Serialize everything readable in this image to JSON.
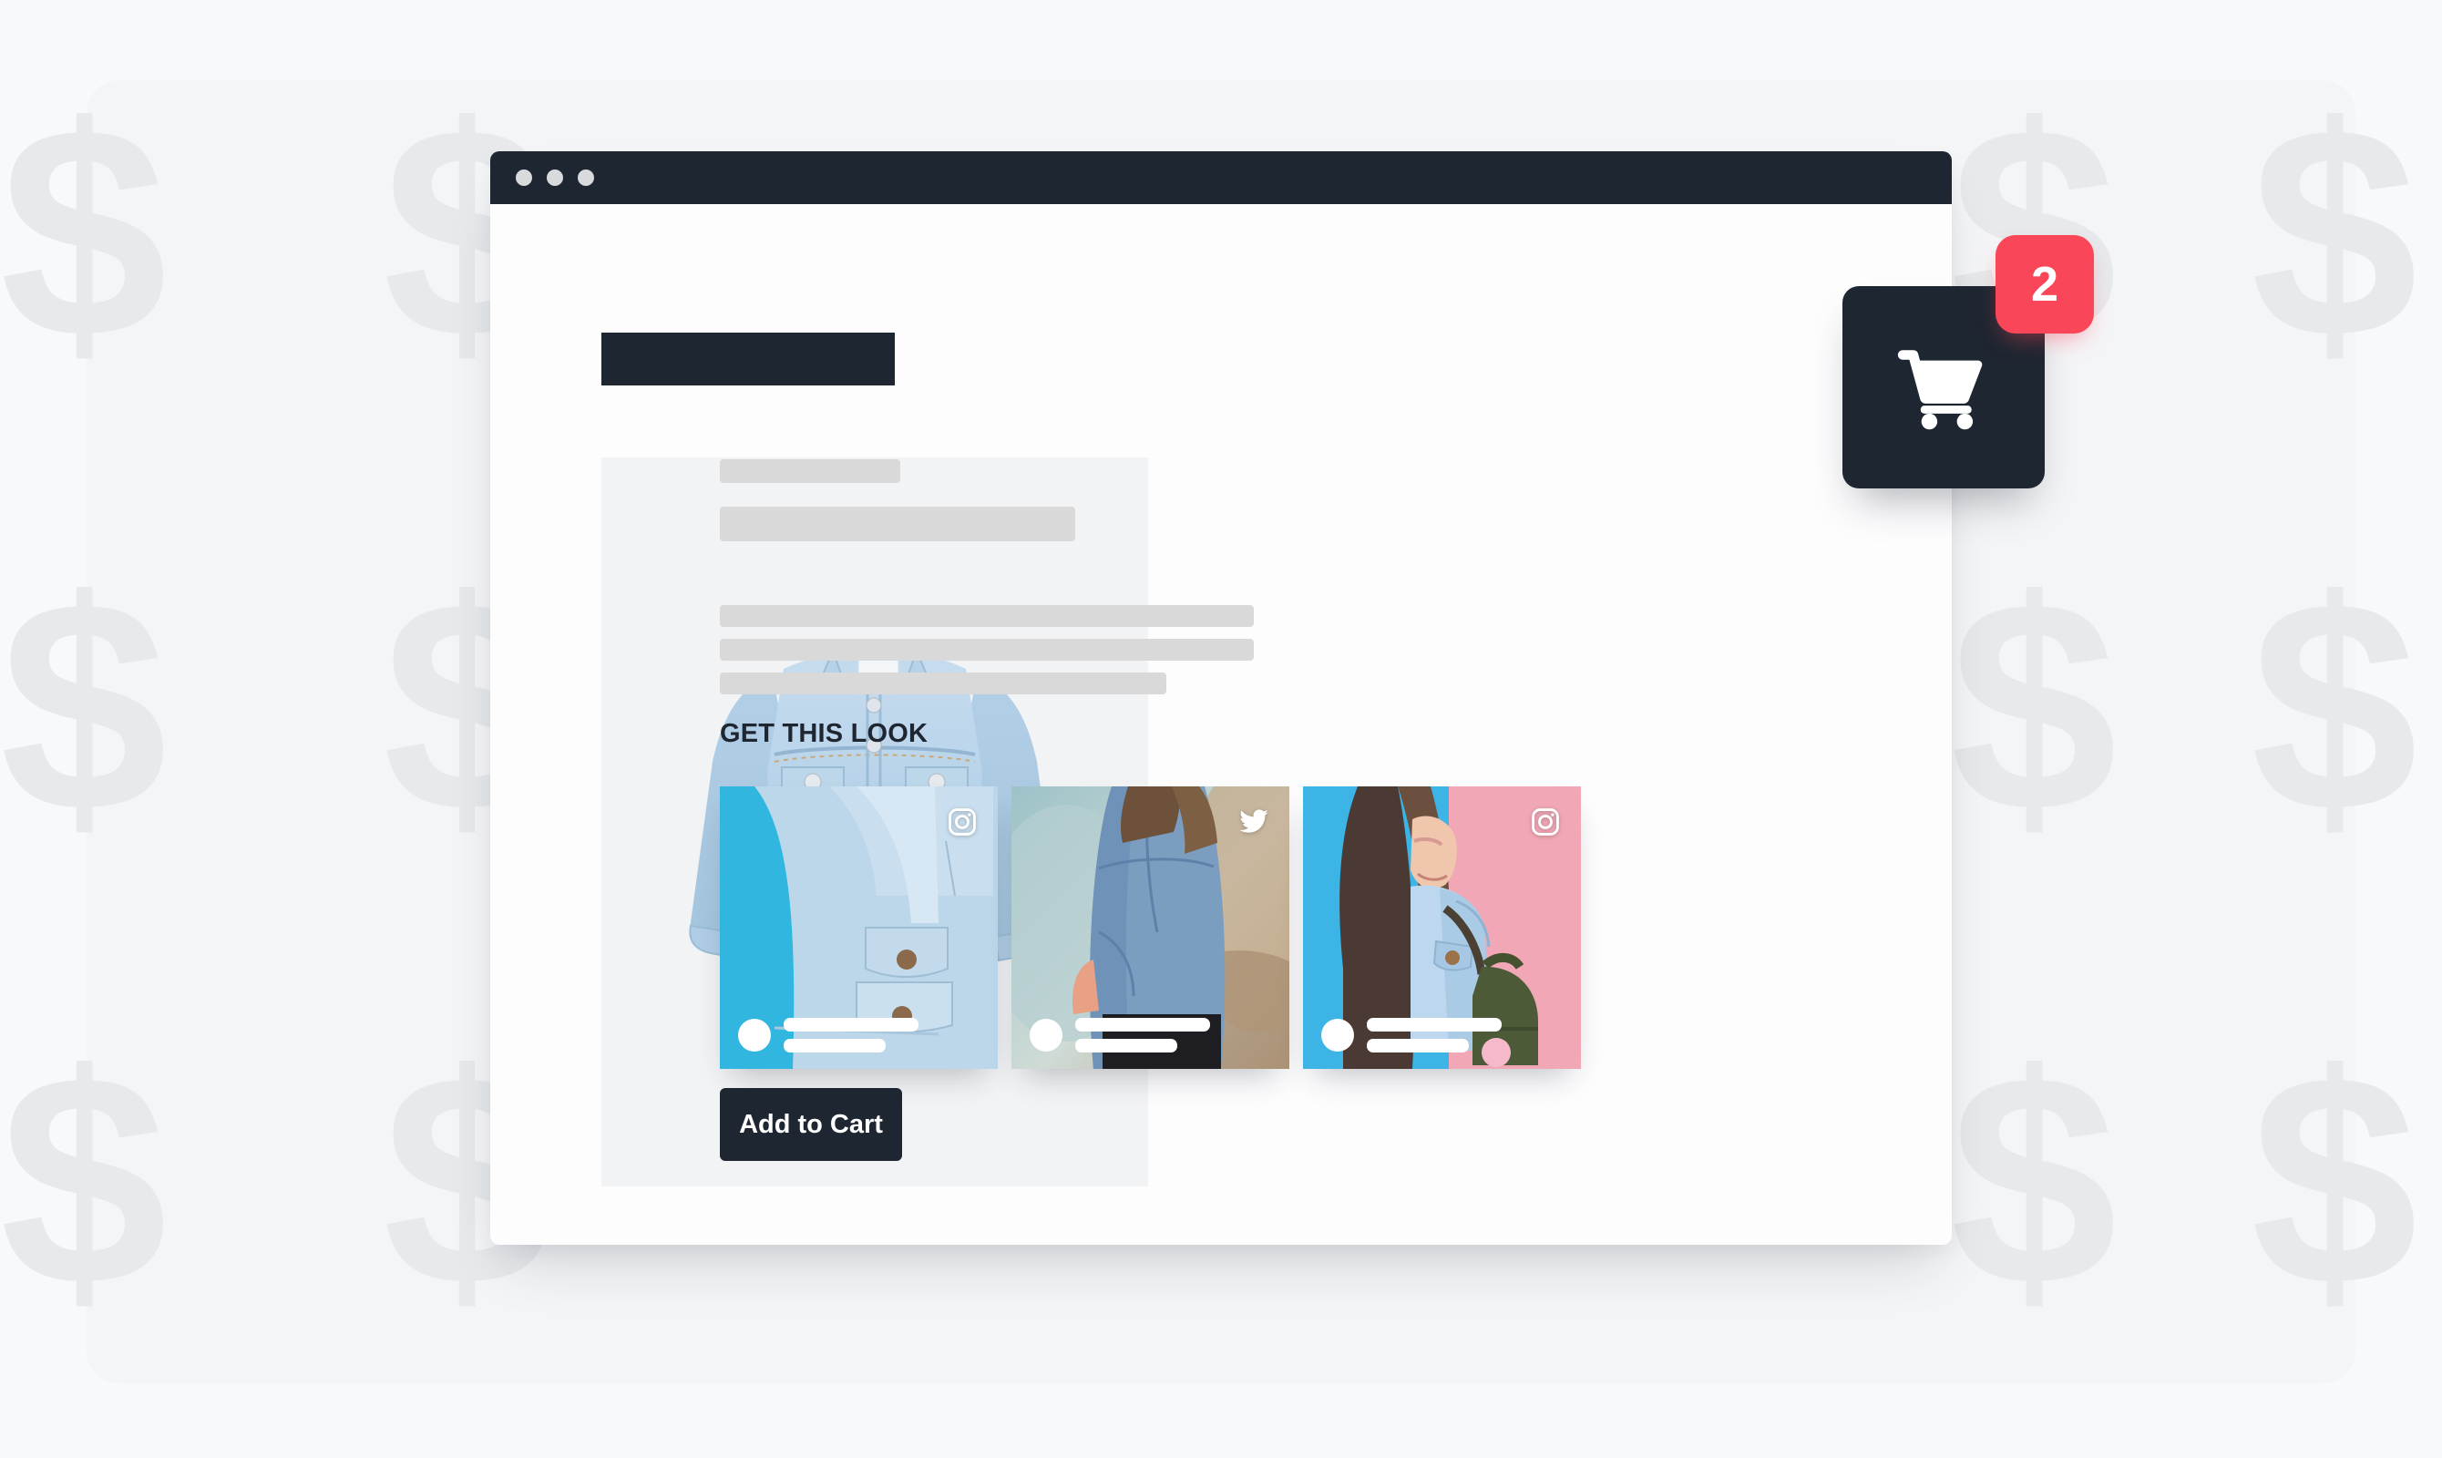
{
  "background": {
    "watermark_symbol": "$",
    "card_color": "#f4f5f7",
    "page_color": "#f8f9fb"
  },
  "browser": {
    "chrome_color": "#1e2631",
    "traffic_lights": [
      "close-dot",
      "minimize-dot",
      "maximize-dot"
    ]
  },
  "store": {
    "logo_placeholder": "",
    "product_image_alt": "light-wash cropped denim jacket",
    "skeleton_blocks": [
      "title-skeleton",
      "subtitle-skeleton",
      "body-line-1",
      "body-line-2",
      "body-line-3"
    ]
  },
  "get_this_look": {
    "heading": "GET THIS LOOK",
    "cards": [
      {
        "id": "card-1",
        "network": "instagram",
        "icon": "instagram-icon",
        "alt": "close-up of light blue denim jacket pocket on blue background"
      },
      {
        "id": "card-2",
        "network": "twitter",
        "icon": "twitter-icon",
        "alt": "woman from behind wearing oversized denim jacket outdoors"
      },
      {
        "id": "card-3",
        "network": "instagram",
        "icon": "instagram-icon",
        "alt": "woman in denim jacket with green backpack against blue and pink wall"
      }
    ]
  },
  "actions": {
    "add_to_cart_label": "Add to Cart"
  },
  "cart": {
    "icon": "shopping-cart-icon",
    "badge_count": "2",
    "badge_color": "#fa4659",
    "button_color": "#1e2631"
  }
}
